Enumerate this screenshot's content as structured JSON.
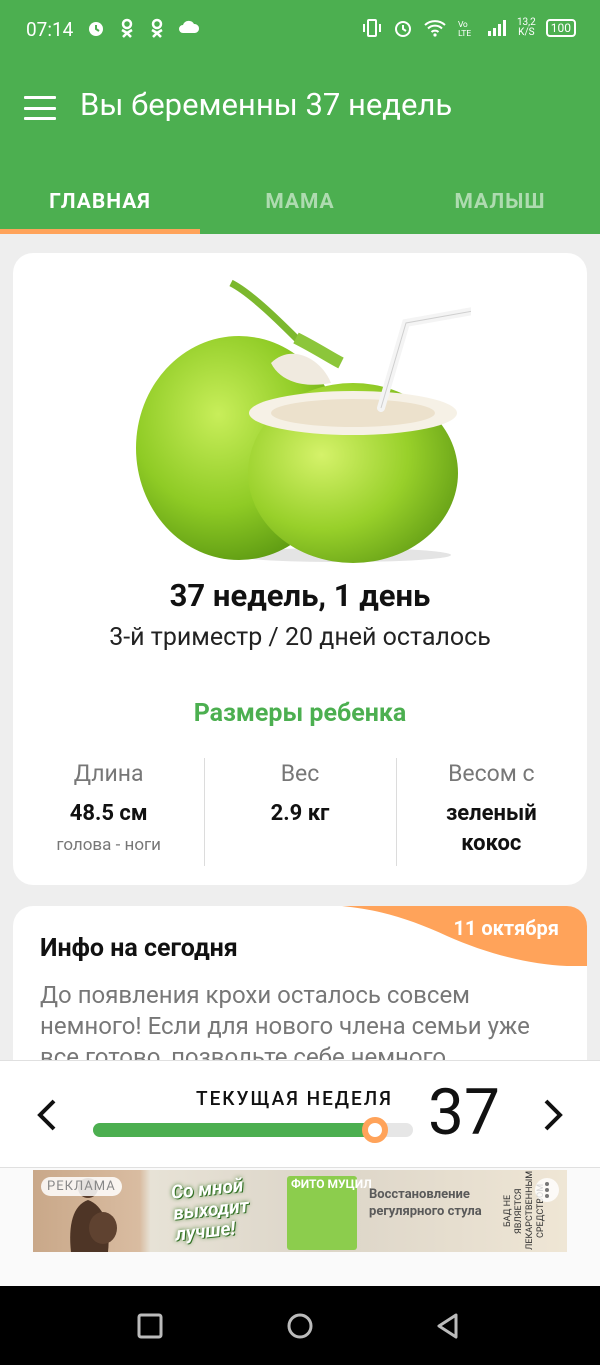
{
  "status_bar": {
    "time": "07:14",
    "left_icons": [
      "alarm-icon",
      "ok-icon",
      "ok-icon",
      "cloud-icon"
    ],
    "network": "13,2\nK/S",
    "battery": "100"
  },
  "app_bar": {
    "title": "Вы беременны 37 недель",
    "menu_icon": "hamburger-menu-icon"
  },
  "tabs": [
    {
      "label": "ГЛАВНАЯ",
      "active": true
    },
    {
      "label": "МАМА",
      "active": false
    },
    {
      "label": "МАЛЫШ",
      "active": false
    }
  ],
  "summary": {
    "week_title": "37 недель, 1 день",
    "subtitle": "3-й триместр / 20 дней осталось",
    "sizes_heading": "Размеры ребенка",
    "stats": [
      {
        "label": "Длина",
        "value": "48.5 см",
        "note": "голова - ноги"
      },
      {
        "label": "Вес",
        "value": "2.9 кг",
        "note": ""
      },
      {
        "label": "Весом с",
        "value": "зеленый кокос",
        "note": ""
      }
    ]
  },
  "info": {
    "date": "11 октября",
    "title": "Инфо на сегодня",
    "text": "До появления крохи осталось совсем немного! Если для нового члена семьи уже все готово, позвольте себе немного"
  },
  "week_nav": {
    "label": "ТЕКУЩАЯ НЕДЕЛЯ",
    "week": "37",
    "progress": 0.88
  },
  "ad": {
    "tag": "РЕКЛАМА",
    "slogan": "Со мной выходит лучше!",
    "brand": "ФИТО МУЦИЛ",
    "product": "Восстановление регулярного стула",
    "disclaimer": "БАД НЕ ЯВЛЯЕТСЯ ЛЕКАРСТВЕННЫМ СРЕДСТВОМ"
  },
  "colors": {
    "primary": "#4caf50",
    "accent": "#ffa35a"
  }
}
